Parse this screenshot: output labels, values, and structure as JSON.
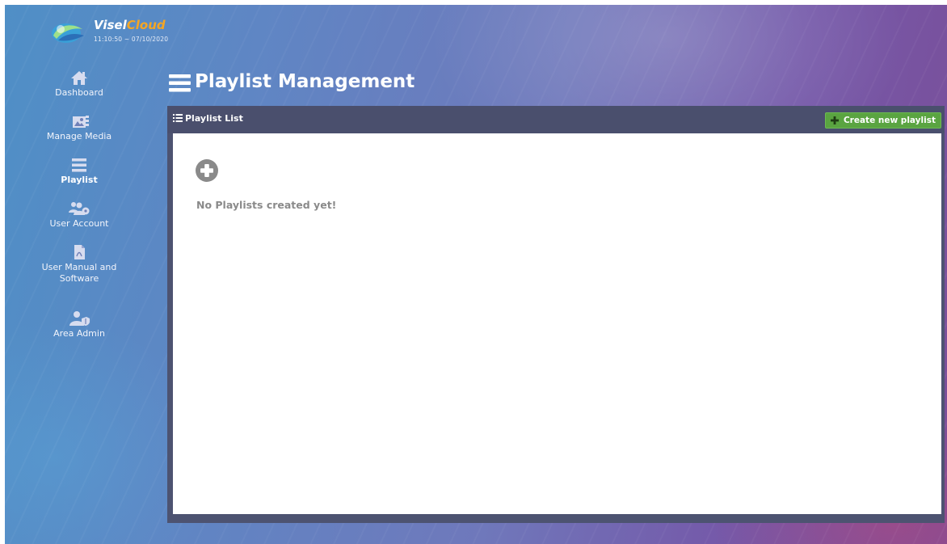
{
  "brand": {
    "name_part1": "Visel",
    "name_part2": "Cloud",
    "datetime": "11:10:50 ~ 07/10/2020",
    "logo_icon": "visel-globe-logo"
  },
  "sidebar": {
    "items": [
      {
        "label": "Dashboard",
        "icon": "home-icon"
      },
      {
        "label": "Manage Media",
        "icon": "media-icon"
      },
      {
        "label": "Playlist",
        "icon": "playlist-icon",
        "active": true
      },
      {
        "label": "User Account",
        "icon": "users-gear-icon"
      },
      {
        "label": "User Manual and Software",
        "icon": "pdf-file-icon"
      },
      {
        "label": "Area Admin",
        "icon": "user-shield-icon"
      }
    ]
  },
  "page": {
    "title": "Playlist Management",
    "title_icon": "bars-icon"
  },
  "panel": {
    "title": "Playlist List",
    "title_icon": "list-icon",
    "create_button": "Create new playlist",
    "create_icon": "plus-icon",
    "add_icon": "plus-circle-icon",
    "empty_message": "No Playlists created yet!"
  },
  "colors": {
    "accent_green": "#5aa441",
    "brand_orange": "#f5a623",
    "panel_dark": "#4a4f6d",
    "empty_text_gray": "#8a8a8a"
  }
}
